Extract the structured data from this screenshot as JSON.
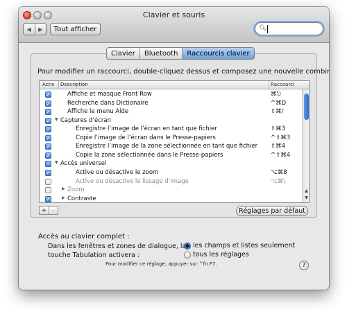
{
  "window": {
    "title": "Clavier et souris"
  },
  "toolbar": {
    "back": "◀",
    "forward": "▶",
    "show_all": "Tout afficher",
    "search_placeholder": ""
  },
  "tabs": [
    {
      "label": "Clavier",
      "active": false
    },
    {
      "label": "Bluetooth",
      "active": false
    },
    {
      "label": "Raccourcis clavier",
      "active": true
    }
  ],
  "instruction": "Pour modifier un raccourci, double-cliquez dessus et composez une nouvelle combinaison.",
  "list": {
    "headers": {
      "active": "Activ",
      "description": "Description",
      "shortcut": "Raccourci"
    },
    "rows": [
      {
        "state": "checked",
        "indent": 1,
        "group": false,
        "disabled": false,
        "description": "Affiche et masque Front Row",
        "shortcut": "⌘⎋"
      },
      {
        "state": "checked",
        "indent": 1,
        "group": false,
        "disabled": false,
        "description": "Recherche dans Dictionaire",
        "shortcut": "^⌘D"
      },
      {
        "state": "checked",
        "indent": 1,
        "group": false,
        "disabled": false,
        "description": "Affiche le menu Aide",
        "shortcut": "⇧⌘/"
      },
      {
        "state": "checked",
        "indent": 0,
        "group": true,
        "expanded": true,
        "disabled": false,
        "description": "Captures d’écran",
        "shortcut": ""
      },
      {
        "state": "checked",
        "indent": 2,
        "group": false,
        "disabled": false,
        "description": "Enregistre l’image de l’écran en tant que fichier",
        "shortcut": "⇧⌘3"
      },
      {
        "state": "checked",
        "indent": 2,
        "group": false,
        "disabled": false,
        "description": "Copie l’image de l’écran dans le Presse-papiers",
        "shortcut": "^⇧⌘3"
      },
      {
        "state": "checked",
        "indent": 2,
        "group": false,
        "disabled": false,
        "description": "Enregistre l’image de la zone sélectionnée en tant que fichier",
        "shortcut": "⇧⌘4"
      },
      {
        "state": "checked",
        "indent": 2,
        "group": false,
        "disabled": false,
        "description": "Copie la zone sélectionnée dans le Presse-papiers",
        "shortcut": "^⇧⌘4"
      },
      {
        "state": "mixed",
        "indent": 0,
        "group": true,
        "expanded": true,
        "disabled": false,
        "description": "Accès universel",
        "shortcut": ""
      },
      {
        "state": "checked",
        "indent": 2,
        "group": false,
        "disabled": false,
        "description": "Active ou désactive le zoom",
        "shortcut": "⌥⌘8"
      },
      {
        "state": "unchecked",
        "indent": 2,
        "group": false,
        "disabled": true,
        "description": "Active ou désactive le lissage d’image",
        "shortcut": "⌥⌘\\"
      },
      {
        "state": "unchecked",
        "indent": 1,
        "group": true,
        "expanded": false,
        "disabled": true,
        "description": "Zoom",
        "shortcut": ""
      },
      {
        "state": "checked",
        "indent": 1,
        "group": true,
        "expanded": false,
        "disabled": false,
        "description": "Contraste",
        "shortcut": ""
      }
    ]
  },
  "buttons": {
    "add": "+",
    "remove": "–",
    "defaults": "Réglages par défaut"
  },
  "full_keyboard_access": {
    "title": "Accès au clavier complet :",
    "label_line1": "Dans les fenêtres et zones de dialogue, la",
    "label_line2": "touche Tabulation activera :",
    "options": [
      {
        "label": "les champs et listes seulement",
        "selected": true
      },
      {
        "label": "tous les réglages",
        "selected": false
      }
    ],
    "note": "Pour modifier ce réglage, appuyer sur ^fn F7."
  },
  "help": "?"
}
